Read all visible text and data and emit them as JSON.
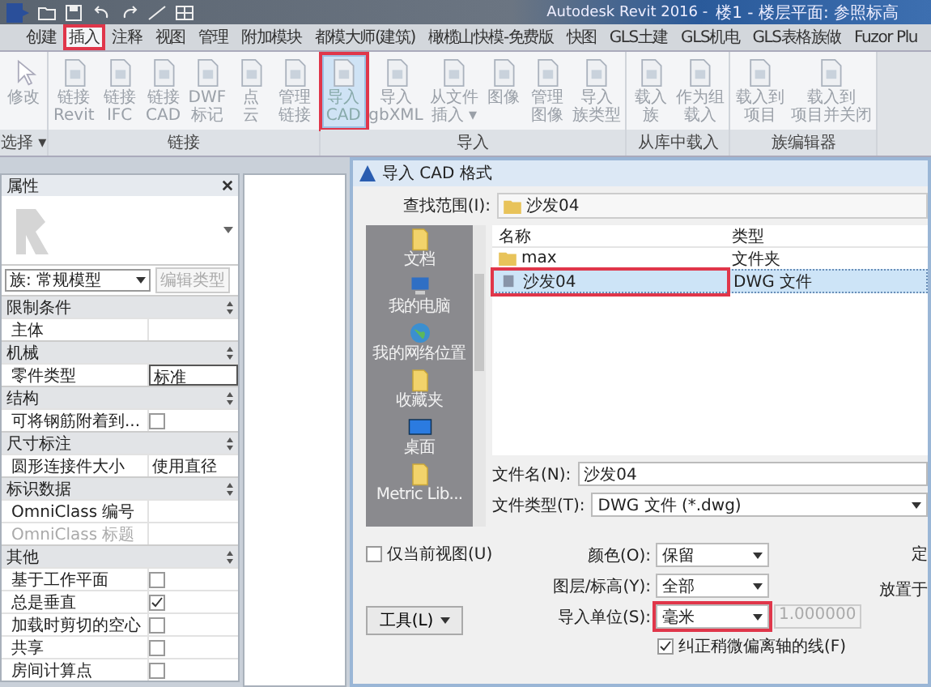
{
  "title_bar": {
    "title": "Autodesk Revit 2016 -",
    "document": "楼1 - 楼层平面: 参照标高"
  },
  "tabs": [
    {
      "label": "创建",
      "selected": false,
      "annotated": false
    },
    {
      "label": "插入",
      "selected": true,
      "annotated": true
    },
    {
      "label": "注释",
      "selected": false,
      "annotated": false
    },
    {
      "label": "视图",
      "selected": false,
      "annotated": false
    },
    {
      "label": "管理",
      "selected": false,
      "annotated": false
    },
    {
      "label": "附加模块",
      "selected": false,
      "annotated": false
    },
    {
      "label": "都模大师(建筑)",
      "selected": false,
      "annotated": false
    },
    {
      "label": "橄榄山快模-免费版",
      "selected": false,
      "annotated": false
    },
    {
      "label": "快图",
      "selected": false,
      "annotated": false
    },
    {
      "label": "GLS土建",
      "selected": false,
      "annotated": false
    },
    {
      "label": "GLS机电",
      "selected": false,
      "annotated": false
    },
    {
      "label": "GLS表格族做",
      "selected": false,
      "annotated": false
    },
    {
      "label": "Fuzor Plu",
      "selected": false,
      "annotated": false
    }
  ],
  "ribbon": {
    "groups": [
      {
        "label": "选择 ▾",
        "buttons": [
          {
            "line1": "修改",
            "selected": false,
            "annotated": false
          }
        ]
      },
      {
        "label": "链接",
        "buttons": [
          {
            "line1": "链接",
            "line2": "Revit",
            "selected": false,
            "annotated": false
          },
          {
            "line1": "链接",
            "line2": "IFC",
            "selected": false,
            "annotated": false
          },
          {
            "line1": "链接",
            "line2": "CAD",
            "selected": false,
            "annotated": false
          },
          {
            "line1": "DWF",
            "line2": "标记",
            "selected": false,
            "annotated": false
          },
          {
            "line1": "点",
            "line2": "云",
            "selected": false,
            "annotated": false
          },
          {
            "line1": "管理",
            "line2": "链接",
            "selected": false,
            "annotated": false
          }
        ]
      },
      {
        "label": "导入",
        "buttons": [
          {
            "line1": "导入",
            "line2": "CAD",
            "selected": true,
            "annotated": true
          },
          {
            "line1": "导入",
            "line2": "gbXML",
            "selected": false,
            "annotated": false
          },
          {
            "line1": "从文件",
            "line2": "插入 ▾",
            "selected": false,
            "annotated": false
          },
          {
            "line1": "图像",
            "selected": false,
            "annotated": false
          },
          {
            "line1": "管理",
            "line2": "图像",
            "selected": false,
            "annotated": false
          },
          {
            "line1": "导入",
            "line2": "族类型",
            "selected": false,
            "annotated": false
          }
        ]
      },
      {
        "label": "从库中载入",
        "buttons": [
          {
            "line1": "载入",
            "line2": "族",
            "selected": false,
            "annotated": false
          },
          {
            "line1": "作为组",
            "line2": "载入",
            "selected": false,
            "annotated": false
          }
        ]
      },
      {
        "label": "族编辑器",
        "buttons": [
          {
            "line1": "载入到",
            "line2": "项目",
            "selected": false,
            "annotated": false
          },
          {
            "line1": "载入到",
            "line2": "项目并关闭",
            "selected": false,
            "annotated": false
          }
        ]
      }
    ]
  },
  "properties": {
    "title": "属性",
    "type_selector": "族: 常规模型",
    "edit_type_button": "编辑类型",
    "sections": [
      {
        "title": "限制条件",
        "rows": [
          {
            "label": "主体",
            "kind": "text",
            "disabled": false,
            "focused": false
          }
        ]
      },
      {
        "title": "机械",
        "rows": [
          {
            "label": "零件类型",
            "kind": "text",
            "value": "标准",
            "disabled": false,
            "focused": true
          }
        ]
      },
      {
        "title": "结构",
        "rows": [
          {
            "label": "可将钢筋附着到...",
            "kind": "checkbox",
            "checked": false,
            "disabled": false,
            "focused": false
          }
        ]
      },
      {
        "title": "尺寸标注",
        "rows": [
          {
            "label": "圆形连接件大小",
            "kind": "text",
            "value": "使用直径",
            "disabled": false,
            "focused": false
          }
        ]
      },
      {
        "title": "标识数据",
        "rows": [
          {
            "label": "OmniClass 编号",
            "kind": "text",
            "disabled": false,
            "focused": false
          },
          {
            "label": "OmniClass 标题",
            "kind": "text",
            "disabled": true,
            "focused": false
          }
        ]
      },
      {
        "title": "其他",
        "rows": [
          {
            "label": "基于工作平面",
            "kind": "checkbox",
            "checked": false,
            "disabled": false,
            "focused": false
          },
          {
            "label": "总是垂直",
            "kind": "checkbox",
            "checked": true,
            "disabled": false,
            "focused": false
          },
          {
            "label": "加载时剪切的空心",
            "kind": "checkbox",
            "checked": false,
            "disabled": false,
            "focused": false
          },
          {
            "label": "共享",
            "kind": "checkbox",
            "checked": false,
            "disabled": false,
            "focused": false
          },
          {
            "label": "房间计算点",
            "kind": "checkbox",
            "checked": false,
            "disabled": false,
            "focused": false
          }
        ]
      }
    ]
  },
  "dialog": {
    "title": "导入 CAD 格式",
    "look_in_label": "查找范围(I):",
    "look_in": "沙发04",
    "places": [
      {
        "label": "文档"
      },
      {
        "label": "我的电脑"
      },
      {
        "label": "我的网络位置"
      },
      {
        "label": "收藏夹"
      },
      {
        "label": "桌面"
      },
      {
        "label": "Metric Lib..."
      }
    ],
    "columns": [
      "名称",
      "类型"
    ],
    "files": [
      {
        "name": "max",
        "type": "文件夹",
        "kind": "folder",
        "selected": false,
        "annotated": false
      },
      {
        "name": "沙发04",
        "type": "DWG 文件",
        "kind": "dwg",
        "selected": true,
        "annotated": true
      }
    ],
    "file_name_label": "文件名(N):",
    "file_name": "沙发04",
    "file_type_label": "文件类型(T):",
    "file_type": "DWG 文件 (*.dwg)",
    "current_view_only": {
      "label": "仅当前视图(U)",
      "checked": false
    },
    "colors": {
      "label": "颜色(O):",
      "value": "保留",
      "annotated": false
    },
    "layers": {
      "label": "图层/标高(Y):",
      "value": "全部",
      "annotated": false
    },
    "units": {
      "label": "导入单位(S):",
      "value": "毫米",
      "annotated": true
    },
    "scale": {
      "value": "1.000000",
      "disabled": true
    },
    "correct_lines": {
      "label": "纠正稍微偏离轴的线(F)",
      "checked": true
    },
    "column_3": [
      "定",
      "放置于"
    ],
    "tools_button": "工具(L)"
  }
}
